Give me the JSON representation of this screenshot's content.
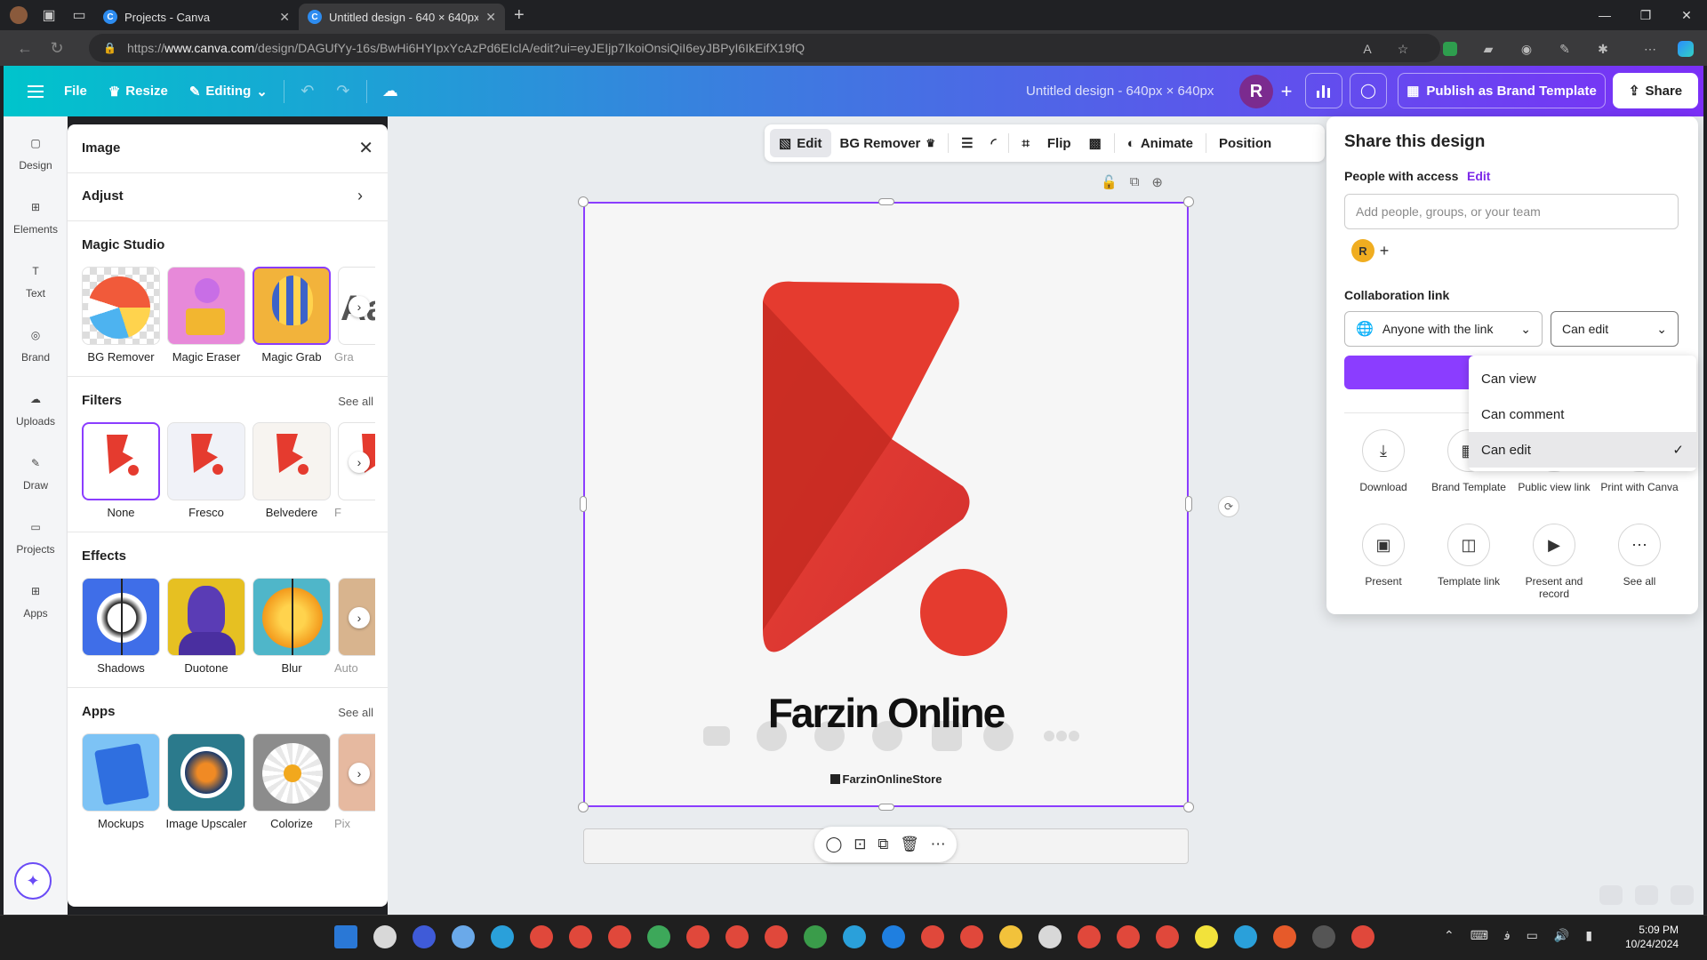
{
  "browser": {
    "tabs": [
      {
        "title": "Projects - Canva",
        "active": false
      },
      {
        "title": "Untitled design - 640 × 640px",
        "active": true
      }
    ],
    "url_host": "www.canva.com",
    "url_prefix": "https://",
    "url_path": "/design/DAGUfYy-16s/BwHi6HYIpxYcAzPd6EIclA/edit?ui=eyJEIjp7IkoiOnsiQiI6eyJBPyI6IkEifX19fQ"
  },
  "header": {
    "menu_icon": "hamburger-icon",
    "file": "File",
    "resize": "Resize",
    "editing": "Editing",
    "doc_title": "Untitled design - 640px × 640px",
    "avatar_initial": "R",
    "publish": "Publish as Brand Template",
    "share": "Share"
  },
  "rail": [
    {
      "label": "Design",
      "icon": "design-icon"
    },
    {
      "label": "Elements",
      "icon": "elements-icon"
    },
    {
      "label": "Text",
      "icon": "text-icon"
    },
    {
      "label": "Brand",
      "icon": "brand-icon"
    },
    {
      "label": "Uploads",
      "icon": "uploads-icon"
    },
    {
      "label": "Draw",
      "icon": "draw-icon"
    },
    {
      "label": "Projects",
      "icon": "projects-icon"
    },
    {
      "label": "Apps",
      "icon": "apps-icon"
    }
  ],
  "panel": {
    "title": "Image",
    "adjust": "Adjust",
    "magic_studio": {
      "heading": "Magic Studio",
      "items": [
        "BG Remover",
        "Magic Eraser",
        "Magic Grab",
        "Gra"
      ]
    },
    "filters": {
      "heading": "Filters",
      "see_all": "See all",
      "items": [
        "None",
        "Fresco",
        "Belvedere",
        "F"
      ]
    },
    "effects": {
      "heading": "Effects",
      "items": [
        "Shadows",
        "Duotone",
        "Blur",
        "Auto"
      ]
    },
    "apps": {
      "heading": "Apps",
      "see_all": "See all",
      "items": [
        "Mockups",
        "Image Upscaler",
        "Colorize",
        "Pix"
      ]
    }
  },
  "context_toolbar": {
    "edit": "Edit",
    "bg_remover": "BG Remover",
    "flip": "Flip",
    "animate": "Animate",
    "position": "Position"
  },
  "design": {
    "brand_name": "Farzin Online",
    "handle": "FarzinOnlineStore",
    "colors": {
      "primary": "#e53b2f",
      "dark": "#c62a21",
      "frame": "#8b3dff"
    }
  },
  "share_panel": {
    "title": "Share this design",
    "people_label": "People with access",
    "edit_link": "Edit",
    "people_placeholder": "Add people, groups, or your team",
    "avatar_initial": "R",
    "collab_label": "Collaboration link",
    "link_scope": "Anyone with the link",
    "link_permission": "Can edit",
    "actions": [
      {
        "label": "Download",
        "icon": "download-icon"
      },
      {
        "label": "Brand Template",
        "icon": "brand-template-icon"
      },
      {
        "label": "Public view link",
        "icon": "link-icon"
      },
      {
        "label": "Print with Canva",
        "icon": "print-icon"
      },
      {
        "label": "Present",
        "icon": "present-icon"
      },
      {
        "label": "Template link",
        "icon": "template-icon"
      },
      {
        "label": "Present and record",
        "icon": "record-icon"
      },
      {
        "label": "See all",
        "icon": "more-icon"
      }
    ],
    "permission_menu": [
      "Can view",
      "Can comment",
      "Can edit"
    ],
    "permission_selected": "Can edit"
  },
  "taskbar": {
    "time": "5:09 PM",
    "date": "10/24/2024"
  }
}
